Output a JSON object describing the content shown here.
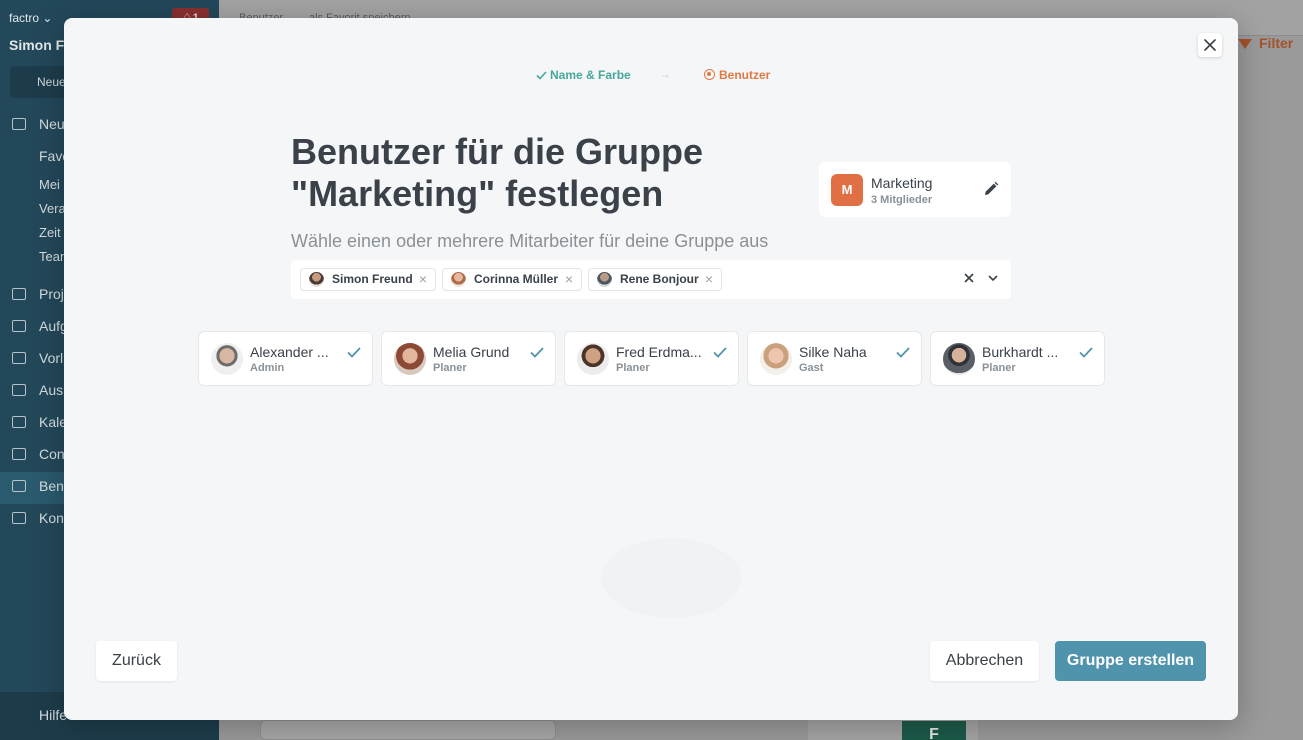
{
  "background": {
    "company": "factro ⌄",
    "user_name": "Simon Fr",
    "notification_count": "1",
    "new_button": "Neue",
    "nav": [
      "Neu",
      "Favo",
      "Mei",
      "Vera",
      "Zeit",
      "Tean",
      "Proj",
      "Aufg",
      "Vorl",
      "Aus",
      "Kale",
      "Con",
      "Ben",
      "Kon"
    ],
    "help": "Hilfe",
    "breadcrumb": "Benutzer",
    "favorite": "als Favorit speichern",
    "filter_label": "Filter",
    "tile_letter": "F"
  },
  "modal": {
    "close_label": "×",
    "stepper": {
      "step1": "Name & Farbe",
      "arrow": "→",
      "step2": "Benutzer"
    },
    "headline": "Benutzer für die Gruppe \"Marketing\" festlegen",
    "subline": "Wähle einen oder mehrere Mitarbeiter für deine Gruppe aus",
    "group": {
      "badge": "M",
      "name": "Marketing",
      "members": "3 Mitglieder",
      "badge_color": "#e07044"
    },
    "selected_chips": [
      {
        "name": "Simon Freund"
      },
      {
        "name": "Corinna Müller"
      },
      {
        "name": "Rene Bonjour"
      }
    ],
    "users": [
      {
        "name": "Alexander ...",
        "role": "Admin"
      },
      {
        "name": "Melia Grund",
        "role": "Planer"
      },
      {
        "name": "Fred Erdma...",
        "role": "Planer"
      },
      {
        "name": "Silke Naha",
        "role": "Gast"
      },
      {
        "name": "Burkhardt ...",
        "role": "Planer"
      }
    ],
    "buttons": {
      "back": "Zurück",
      "cancel": "Abbrechen",
      "create": "Gruppe erstellen"
    },
    "colors": {
      "accent": "#4f93ad",
      "success": "#45a89a",
      "active_step": "#e07a44"
    }
  }
}
